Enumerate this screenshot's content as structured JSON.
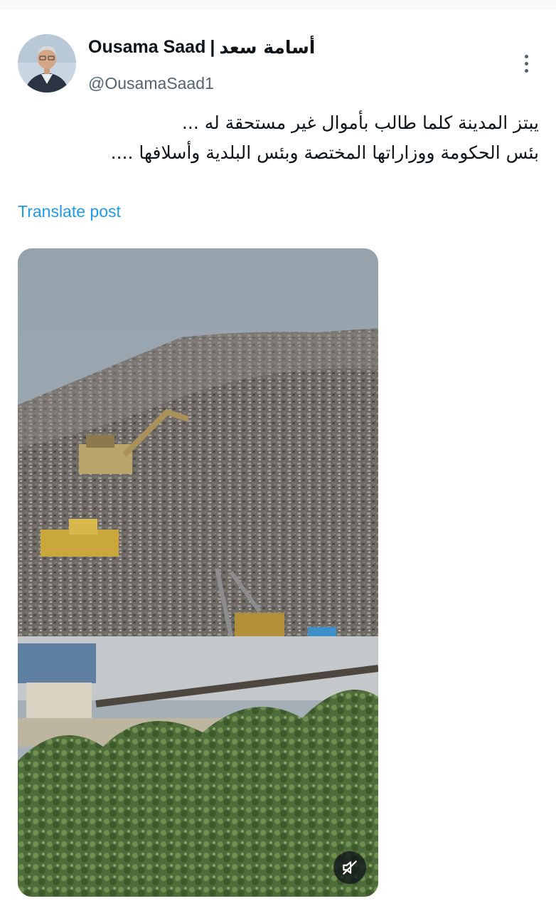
{
  "tweet": {
    "author_name": "Ousama Saad",
    "author_separator": "|",
    "author_name_ar": "أسامة سعد",
    "handle": "@OusamaSaad1",
    "text_lines": [
      "يبتز المدينة كلما طالب بأموال غير مستحقة له ...",
      "بئس الحكومة ووزاراتها المختصة وبئس البلدية وأسلافها ...."
    ],
    "translate_label": "Translate post",
    "more_icon": "more-vertical-icon"
  },
  "media": {
    "type": "video",
    "description_icon": "garbage-mountain-video",
    "mute_icon": "volume-muted-icon"
  },
  "colors": {
    "link": "#1d9bf0",
    "secondary_text": "#536471",
    "primary_text": "#0f1419"
  }
}
